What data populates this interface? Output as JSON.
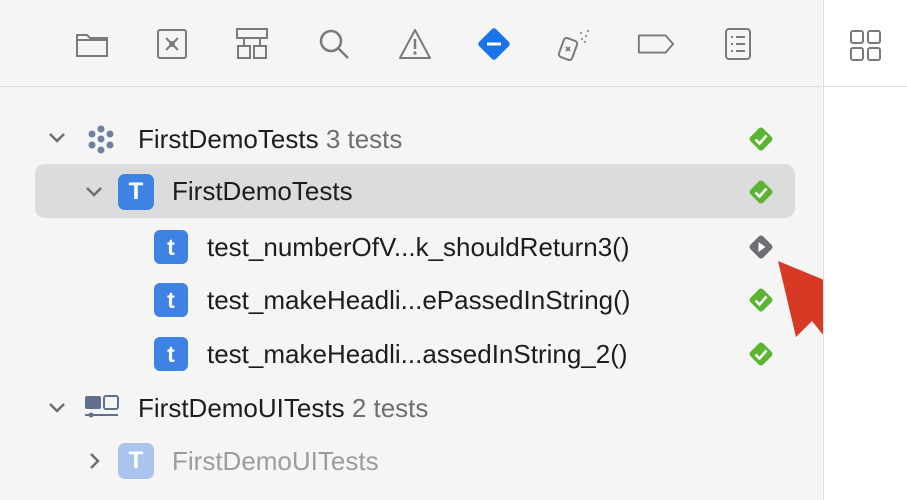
{
  "toolbar": {
    "icons": [
      "folder-icon",
      "source-control-icon",
      "hierarchy-icon",
      "search-icon",
      "warning-icon",
      "test-navigator-icon",
      "debug-icon",
      "breakpoint-icon",
      "report-icon"
    ],
    "active": "test-navigator-icon",
    "accent": "#1a73e8"
  },
  "right_panel": {
    "icon": "grid-icon"
  },
  "tree": {
    "project": {
      "name": "FirstDemoTests",
      "count": "3 tests",
      "status": "passed"
    },
    "suite": {
      "badge": "T",
      "name": "FirstDemoTests",
      "status": "passed",
      "selected": true
    },
    "tests": [
      {
        "badge": "t",
        "name": "test_numberOfV...k_shouldReturn3()",
        "status": "run"
      },
      {
        "badge": "t",
        "name": "test_makeHeadli...ePassedInString()",
        "status": "passed"
      },
      {
        "badge": "t",
        "name": "test_makeHeadli...assedInString_2()",
        "status": "passed"
      }
    ],
    "ui_project": {
      "name": "FirstDemoUITests",
      "count": "2 tests"
    },
    "ui_suite": {
      "badge": "T",
      "name": "FirstDemoUITests"
    }
  },
  "colors": {
    "pass": "#5cb531",
    "badge": "#3e82e4",
    "arrow": "#d63a25"
  }
}
